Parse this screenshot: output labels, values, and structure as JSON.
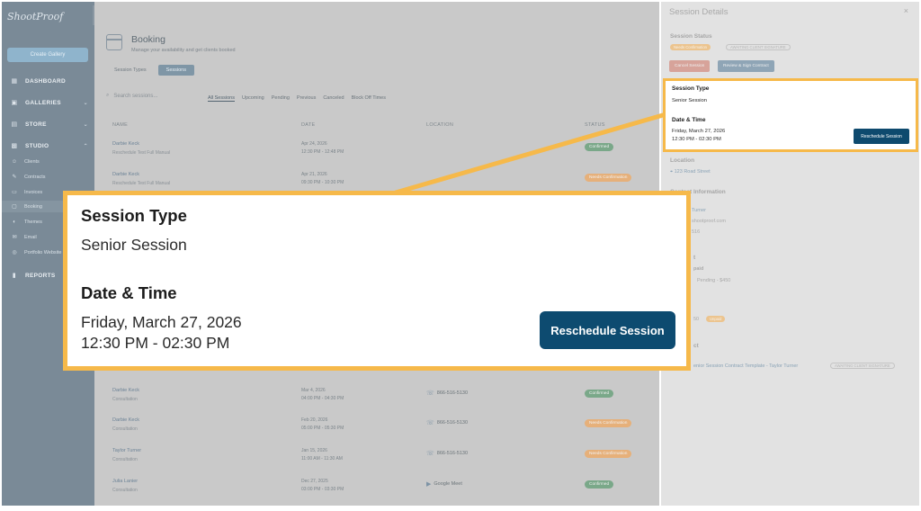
{
  "colors": {
    "highlight": "#f6b94a",
    "primary_button": "#0d4b70",
    "sidebar": "#7a8a97",
    "confirmed": "#7aa889",
    "needs_confirmation": "#e6b07a"
  },
  "sidebar": {
    "create_gallery": "Create Gallery",
    "nav": [
      {
        "label": "DASHBOARD",
        "icon": "dashboard-icon"
      },
      {
        "label": "GALLERIES",
        "icon": "galleries-icon"
      },
      {
        "label": "STORE",
        "icon": "store-icon"
      },
      {
        "label": "STUDIO",
        "icon": "studio-icon"
      },
      {
        "label": "REPORTS",
        "icon": "reports-icon"
      }
    ],
    "studio_items": [
      {
        "label": "Clients",
        "icon": "clients-icon"
      },
      {
        "label": "Contracts",
        "icon": "contracts-icon"
      },
      {
        "label": "Invoices",
        "icon": "invoices-icon"
      },
      {
        "label": "Booking",
        "icon": "booking-icon",
        "active": true
      },
      {
        "label": "Themes",
        "icon": "themes-icon"
      },
      {
        "label": "Email",
        "icon": "email-icon"
      },
      {
        "label": "Portfolio Website",
        "icon": "portfolio-icon"
      }
    ]
  },
  "main": {
    "title": "Booking",
    "subtitle": "Manage your availability and get clients booked",
    "tabs": [
      "Session Types",
      "Sessions"
    ],
    "search_placeholder": "Search sessions...",
    "filters": [
      "All Sessions",
      "Upcoming",
      "Pending",
      "Previous",
      "Canceled",
      "Block Off Times"
    ],
    "columns": [
      "NAME",
      "DATE",
      "LOCATION",
      "STATUS"
    ],
    "rows_top": [
      {
        "name": "Darbie Keck",
        "sub": "Reschedule Test Full Manual",
        "date": "Apr 24, 2026",
        "time": "12:30 PM - 12:48 PM",
        "location": "",
        "status": "Confirmed"
      },
      {
        "name": "Darbie Keck",
        "sub": "Reschedule Test Full Manual",
        "date": "Apr 21, 2026",
        "time": "09:30 PM - 10:30 PM",
        "location": "",
        "status": "Needs Confirmation"
      }
    ],
    "rows_bottom": [
      {
        "name": "Darbie Keck",
        "sub": "Consultation",
        "date": "Mar 4, 2026",
        "time": "04:00 PM - 04:30 PM",
        "location": "866-516-5130",
        "status": "Confirmed"
      },
      {
        "name": "Darbie Keck",
        "sub": "Consultation",
        "date": "Feb 20, 2026",
        "time": "05:00 PM - 05:30 PM",
        "location": "866-516-5130",
        "status": "Needs Confirmation"
      },
      {
        "name": "Taylor Turner",
        "sub": "Consultation",
        "date": "Jan 15, 2026",
        "time": "11:00 AM - 11:30 AM",
        "location": "866-516-5130",
        "status": "Needs Confirmation"
      },
      {
        "name": "Julia Lanier",
        "sub": "Consultation",
        "date": "Dec 27, 2025",
        "time": "03:00 PM - 03:30 PM",
        "location": "Google Meet",
        "status": "Confirmed"
      }
    ]
  },
  "panel": {
    "title": "Session Details",
    "close": "×",
    "status_label": "Session Status",
    "status_pill": "Needs Confirmation",
    "contract_pill": "AWAITING CLIENT SIGNATURE",
    "cancel_button": "Cancel Session",
    "review_button": "Review & Sign Contract",
    "session_type_label": "Session Type",
    "session_type": "Senior Session",
    "date_time_label": "Date & Time",
    "date": "Friday, March 27, 2026",
    "time": "12:30 PM - 02:30 PM",
    "reschedule_button": "Reschedule Session",
    "location_label": "Location",
    "location": "123 Road Street",
    "contact_label": "Contact Information",
    "contact_name": "Turner",
    "contact_email": "shootproof.com",
    "contact_phone": "516",
    "payment_label": "t",
    "payment_status": "paid",
    "payment_pending": "Pending - $450",
    "invoice_amount": "50",
    "invoice_pill": "Unpaid",
    "contract_label": "ct",
    "contract_name": "enior Session Contract Template - Taylor Turner",
    "contract_status": "AWAITING CLIENT SIGNATURE"
  },
  "callout": {
    "session_type_label": "Session Type",
    "session_type": "Senior Session",
    "date_time_label": "Date & Time",
    "date": "Friday, March 27, 2026",
    "time": "12:30 PM - 02:30 PM",
    "reschedule_button": "Reschedule Session"
  }
}
